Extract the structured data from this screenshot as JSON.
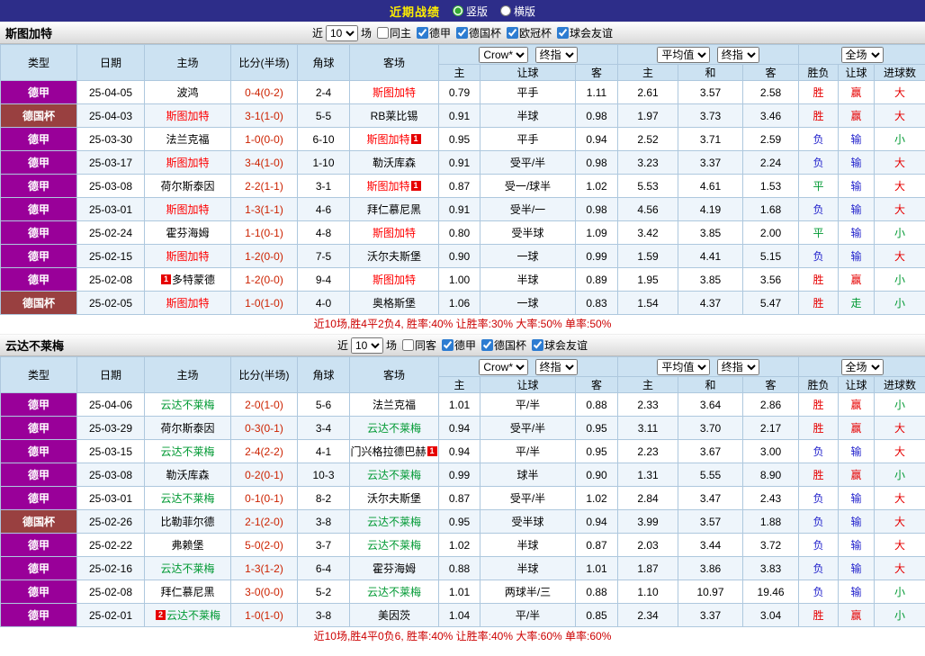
{
  "top_bar": {
    "title": "近期战绩",
    "options": [
      {
        "label": "竖版",
        "selected": true
      },
      {
        "label": "横版",
        "selected": false
      }
    ]
  },
  "colors": {
    "league_bg": "#990099",
    "cup_bg": "#994040",
    "win": "#e60000",
    "draw": "#009933",
    "loss": "#2222cc",
    "score": "#cc2200",
    "summary": "#cc0000"
  },
  "sections": [
    {
      "team": "斯图加特",
      "accent": "#ff0000",
      "filter": {
        "prefix": "近",
        "count": "10",
        "suffix": "场",
        "checkboxes": [
          {
            "label": "同主",
            "checked": false
          },
          {
            "label": "德甲",
            "checked": true
          },
          {
            "label": "德国杯",
            "checked": true
          },
          {
            "label": "欧冠杯",
            "checked": true
          },
          {
            "label": "球会友谊",
            "checked": true
          }
        ]
      },
      "header": {
        "col_type": "类型",
        "col_date": "日期",
        "col_home": "主场",
        "col_score": "比分(半场)",
        "col_corner": "角球",
        "col_away": "客场",
        "dd_asia_source": "Crow*",
        "dd_asia_time": "终指",
        "dd_euro_source": "平均值",
        "dd_euro_time": "终指",
        "dd_scope": "全场",
        "sub": [
          "主",
          "让球",
          "客",
          "主",
          "和",
          "客",
          "胜负",
          "让球",
          "进球数"
        ]
      },
      "rows": [
        {
          "type": "德甲",
          "cup": false,
          "date": "25-04-05",
          "home": {
            "name": "波鸿"
          },
          "score": "0-4(0-2)",
          "corner": "2-4",
          "away": {
            "name": "斯图加特",
            "hl": true
          },
          "asia_home": "0.79",
          "handicap": "平手",
          "asia_away": "1.11",
          "euro_home": "2.61",
          "euro_draw": "3.57",
          "euro_away": "2.58",
          "result": "胜",
          "handicap_result": "赢",
          "goals": "大"
        },
        {
          "type": "德国杯",
          "cup": true,
          "date": "25-04-03",
          "home": {
            "name": "斯图加特",
            "hl": true
          },
          "score": "3-1(1-0)",
          "corner": "5-5",
          "away": {
            "name": "RB莱比锡"
          },
          "asia_home": "0.91",
          "handicap": "半球",
          "asia_away": "0.98",
          "euro_home": "1.97",
          "euro_draw": "3.73",
          "euro_away": "3.46",
          "result": "胜",
          "handicap_result": "赢",
          "goals": "大"
        },
        {
          "type": "德甲",
          "cup": false,
          "date": "25-03-30",
          "home": {
            "name": "法兰克福"
          },
          "score": "1-0(0-0)",
          "corner": "6-10",
          "away": {
            "name": "斯图加特",
            "hl": true,
            "badge": "1",
            "badge_pos": "after"
          },
          "asia_home": "0.95",
          "handicap": "平手",
          "asia_away": "0.94",
          "euro_home": "2.52",
          "euro_draw": "3.71",
          "euro_away": "2.59",
          "result": "负",
          "handicap_result": "输",
          "goals": "小"
        },
        {
          "type": "德甲",
          "cup": false,
          "date": "25-03-17",
          "home": {
            "name": "斯图加特",
            "hl": true
          },
          "score": "3-4(1-0)",
          "corner": "1-10",
          "away": {
            "name": "勒沃库森"
          },
          "asia_home": "0.91",
          "handicap": "受平/半",
          "asia_away": "0.98",
          "euro_home": "3.23",
          "euro_draw": "3.37",
          "euro_away": "2.24",
          "result": "负",
          "handicap_result": "输",
          "goals": "大"
        },
        {
          "type": "德甲",
          "cup": false,
          "date": "25-03-08",
          "home": {
            "name": "荷尔斯泰因"
          },
          "score": "2-2(1-1)",
          "corner": "3-1",
          "away": {
            "name": "斯图加特",
            "hl": true,
            "badge": "1",
            "badge_pos": "after"
          },
          "asia_home": "0.87",
          "handicap": "受一/球半",
          "asia_away": "1.02",
          "euro_home": "5.53",
          "euro_draw": "4.61",
          "euro_away": "1.53",
          "result": "平",
          "handicap_result": "输",
          "goals": "大"
        },
        {
          "type": "德甲",
          "cup": false,
          "date": "25-03-01",
          "home": {
            "name": "斯图加特",
            "hl": true
          },
          "score": "1-3(1-1)",
          "corner": "4-6",
          "away": {
            "name": "拜仁慕尼黑"
          },
          "asia_home": "0.91",
          "handicap": "受半/一",
          "asia_away": "0.98",
          "euro_home": "4.56",
          "euro_draw": "4.19",
          "euro_away": "1.68",
          "result": "负",
          "handicap_result": "输",
          "goals": "大"
        },
        {
          "type": "德甲",
          "cup": false,
          "date": "25-02-24",
          "home": {
            "name": "霍芬海姆"
          },
          "score": "1-1(0-1)",
          "corner": "4-8",
          "away": {
            "name": "斯图加特",
            "hl": true
          },
          "asia_home": "0.80",
          "handicap": "受半球",
          "asia_away": "1.09",
          "euro_home": "3.42",
          "euro_draw": "3.85",
          "euro_away": "2.00",
          "result": "平",
          "handicap_result": "输",
          "goals": "小"
        },
        {
          "type": "德甲",
          "cup": false,
          "date": "25-02-15",
          "home": {
            "name": "斯图加特",
            "hl": true
          },
          "score": "1-2(0-0)",
          "corner": "7-5",
          "away": {
            "name": "沃尔夫斯堡"
          },
          "asia_home": "0.90",
          "handicap": "一球",
          "asia_away": "0.99",
          "euro_home": "1.59",
          "euro_draw": "4.41",
          "euro_away": "5.15",
          "result": "负",
          "handicap_result": "输",
          "goals": "大"
        },
        {
          "type": "德甲",
          "cup": false,
          "date": "25-02-08",
          "home": {
            "name": "多特蒙德",
            "badge": "1",
            "badge_pos": "before"
          },
          "score": "1-2(0-0)",
          "corner": "9-4",
          "away": {
            "name": "斯图加特",
            "hl": true
          },
          "asia_home": "1.00",
          "handicap": "半球",
          "asia_away": "0.89",
          "euro_home": "1.95",
          "euro_draw": "3.85",
          "euro_away": "3.56",
          "result": "胜",
          "handicap_result": "赢",
          "goals": "小"
        },
        {
          "type": "德国杯",
          "cup": true,
          "date": "25-02-05",
          "home": {
            "name": "斯图加特",
            "hl": true
          },
          "score": "1-0(1-0)",
          "corner": "4-0",
          "away": {
            "name": "奥格斯堡"
          },
          "asia_home": "1.06",
          "handicap": "一球",
          "asia_away": "0.83",
          "euro_home": "1.54",
          "euro_draw": "4.37",
          "euro_away": "5.47",
          "result": "胜",
          "handicap_result": "走",
          "goals": "小"
        }
      ],
      "summary": "近10场,胜4平2负4, 胜率:40% 让胜率:30% 大率:50% 单率:50%"
    },
    {
      "team": "云达不莱梅",
      "accent": "#009933",
      "filter": {
        "prefix": "近",
        "count": "10",
        "suffix": "场",
        "checkboxes": [
          {
            "label": "同客",
            "checked": false
          },
          {
            "label": "德甲",
            "checked": true
          },
          {
            "label": "德国杯",
            "checked": true
          },
          {
            "label": "球会友谊",
            "checked": true
          }
        ]
      },
      "header": {
        "col_type": "类型",
        "col_date": "日期",
        "col_home": "主场",
        "col_score": "比分(半场)",
        "col_corner": "角球",
        "col_away": "客场",
        "dd_asia_source": "Crow*",
        "dd_asia_time": "终指",
        "dd_euro_source": "平均值",
        "dd_euro_time": "终指",
        "dd_scope": "全场",
        "sub": [
          "主",
          "让球",
          "客",
          "主",
          "和",
          "客",
          "胜负",
          "让球",
          "进球数"
        ]
      },
      "rows": [
        {
          "type": "德甲",
          "cup": false,
          "date": "25-04-06",
          "home": {
            "name": "云达不莱梅",
            "hl": true
          },
          "score": "2-0(1-0)",
          "corner": "5-6",
          "away": {
            "name": "法兰克福"
          },
          "asia_home": "1.01",
          "handicap": "平/半",
          "asia_away": "0.88",
          "euro_home": "2.33",
          "euro_draw": "3.64",
          "euro_away": "2.86",
          "result": "胜",
          "handicap_result": "赢",
          "goals": "小"
        },
        {
          "type": "德甲",
          "cup": false,
          "date": "25-03-29",
          "home": {
            "name": "荷尔斯泰因"
          },
          "score": "0-3(0-1)",
          "corner": "3-4",
          "away": {
            "name": "云达不莱梅",
            "hl": true
          },
          "asia_home": "0.94",
          "handicap": "受平/半",
          "asia_away": "0.95",
          "euro_home": "3.11",
          "euro_draw": "3.70",
          "euro_away": "2.17",
          "result": "胜",
          "handicap_result": "赢",
          "goals": "大"
        },
        {
          "type": "德甲",
          "cup": false,
          "date": "25-03-15",
          "home": {
            "name": "云达不莱梅",
            "hl": true
          },
          "score": "2-4(2-2)",
          "corner": "4-1",
          "away": {
            "name": "门兴格拉德巴赫",
            "badge": "1",
            "badge_pos": "after"
          },
          "asia_home": "0.94",
          "handicap": "平/半",
          "asia_away": "0.95",
          "euro_home": "2.23",
          "euro_draw": "3.67",
          "euro_away": "3.00",
          "result": "负",
          "handicap_result": "输",
          "goals": "大"
        },
        {
          "type": "德甲",
          "cup": false,
          "date": "25-03-08",
          "home": {
            "name": "勒沃库森"
          },
          "score": "0-2(0-1)",
          "corner": "10-3",
          "away": {
            "name": "云达不莱梅",
            "hl": true
          },
          "asia_home": "0.99",
          "handicap": "球半",
          "asia_away": "0.90",
          "euro_home": "1.31",
          "euro_draw": "5.55",
          "euro_away": "8.90",
          "result": "胜",
          "handicap_result": "赢",
          "goals": "小"
        },
        {
          "type": "德甲",
          "cup": false,
          "date": "25-03-01",
          "home": {
            "name": "云达不莱梅",
            "hl": true
          },
          "score": "0-1(0-1)",
          "corner": "8-2",
          "away": {
            "name": "沃尔夫斯堡"
          },
          "asia_home": "0.87",
          "handicap": "受平/半",
          "asia_away": "1.02",
          "euro_home": "2.84",
          "euro_draw": "3.47",
          "euro_away": "2.43",
          "result": "负",
          "handicap_result": "输",
          "goals": "大"
        },
        {
          "type": "德国杯",
          "cup": true,
          "date": "25-02-26",
          "home": {
            "name": "比勒菲尔德"
          },
          "score": "2-1(2-0)",
          "corner": "3-8",
          "away": {
            "name": "云达不莱梅",
            "hl": true
          },
          "asia_home": "0.95",
          "handicap": "受半球",
          "asia_away": "0.94",
          "euro_home": "3.99",
          "euro_draw": "3.57",
          "euro_away": "1.88",
          "result": "负",
          "handicap_result": "输",
          "goals": "大"
        },
        {
          "type": "德甲",
          "cup": false,
          "date": "25-02-22",
          "home": {
            "name": "弗赖堡"
          },
          "score": "5-0(2-0)",
          "corner": "3-7",
          "away": {
            "name": "云达不莱梅",
            "hl": true
          },
          "asia_home": "1.02",
          "handicap": "半球",
          "asia_away": "0.87",
          "euro_home": "2.03",
          "euro_draw": "3.44",
          "euro_away": "3.72",
          "result": "负",
          "handicap_result": "输",
          "goals": "大"
        },
        {
          "type": "德甲",
          "cup": false,
          "date": "25-02-16",
          "home": {
            "name": "云达不莱梅",
            "hl": true
          },
          "score": "1-3(1-2)",
          "corner": "6-4",
          "away": {
            "name": "霍芬海姆"
          },
          "asia_home": "0.88",
          "handicap": "半球",
          "asia_away": "1.01",
          "euro_home": "1.87",
          "euro_draw": "3.86",
          "euro_away": "3.83",
          "result": "负",
          "handicap_result": "输",
          "goals": "大"
        },
        {
          "type": "德甲",
          "cup": false,
          "date": "25-02-08",
          "home": {
            "name": "拜仁慕尼黑"
          },
          "score": "3-0(0-0)",
          "corner": "5-2",
          "away": {
            "name": "云达不莱梅",
            "hl": true
          },
          "asia_home": "1.01",
          "handicap": "两球半/三",
          "asia_away": "0.88",
          "euro_home": "1.10",
          "euro_draw": "10.97",
          "euro_away": "19.46",
          "result": "负",
          "handicap_result": "输",
          "goals": "小"
        },
        {
          "type": "德甲",
          "cup": false,
          "date": "25-02-01",
          "home": {
            "name": "云达不莱梅",
            "hl": true,
            "badge": "2",
            "badge_pos": "before"
          },
          "score": "1-0(1-0)",
          "corner": "3-8",
          "away": {
            "name": "美因茨"
          },
          "asia_home": "1.04",
          "handicap": "平/半",
          "asia_away": "0.85",
          "euro_home": "2.34",
          "euro_draw": "3.37",
          "euro_away": "3.04",
          "result": "胜",
          "handicap_result": "赢",
          "goals": "小"
        }
      ],
      "summary": "近10场,胜4平0负6, 胜率:40% 让胜率:40% 大率:60% 单率:60%"
    }
  ]
}
